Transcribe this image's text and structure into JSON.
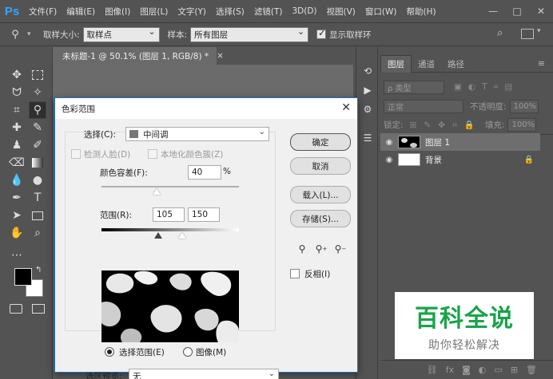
{
  "app": {
    "logo": "Ps",
    "menu": [
      "文件(F)",
      "编辑(E)",
      "图像(I)",
      "图层(L)",
      "文字(Y)",
      "选择(S)",
      "滤镜(T)",
      "3D(D)",
      "视图(V)",
      "窗口(W)",
      "帮助(H)"
    ],
    "window_controls": [
      "—",
      "□",
      "✕"
    ]
  },
  "options_bar": {
    "sample_size_label": "取样大小:",
    "sample_size_value": "取样点",
    "sample_label": "样本:",
    "sample_value": "所有图层",
    "show_ring_label": "显示取样环",
    "show_ring_checked": true
  },
  "document": {
    "tab_title": "未标题-1 @ 50.1% (图层 1, RGB/8) *",
    "tab_close": "×"
  },
  "layers_panel": {
    "tabs": [
      "图层",
      "通道",
      "路径"
    ],
    "active_tab": "图层",
    "filter_label": "ρ 类型",
    "blend_mode": "正常",
    "opacity_label": "不透明度:",
    "opacity_value": "100%",
    "lock_label": "锁定:",
    "fill_label": "填充:",
    "fill_value": "100%",
    "layers": [
      {
        "name": "图层 1",
        "selected": true
      },
      {
        "name": "背景",
        "selected": false
      }
    ],
    "bottom_icons": [
      "link-icon",
      "fx-icon",
      "mask-icon",
      "adjustment-icon",
      "folder-icon",
      "new-layer-icon",
      "trash-icon"
    ]
  },
  "dialog": {
    "title": "色彩范围",
    "close": "✕",
    "select_label": "选择(C):",
    "select_value": "中间调",
    "detect_faces_label": "检测人脸(D)",
    "localized_clusters_label": "本地化颜色簇(Z)",
    "fuzziness_label": "颜色容差(F):",
    "fuzziness_value": "40",
    "fuzziness_unit": "%",
    "range_label": "范围(R):",
    "range_low": "105",
    "range_high": "150",
    "radio_selection": "选择范围(E)",
    "radio_image": "图像(M)",
    "selected_radio": "selection",
    "preview_label": "选区预览:",
    "preview_value": "无",
    "invert_label": "反相(I)",
    "buttons": {
      "ok": "确定",
      "cancel": "取消",
      "load": "载入(L)...",
      "save": "存储(S)..."
    },
    "fuzziness_fraction": 0.4,
    "range_fraction_low": 0.41,
    "range_fraction_high": 0.59
  },
  "watermark": {
    "title": "百科全说",
    "subtitle": "助你轻松解决"
  },
  "colors": {
    "photoshop_blue": "#31a8ff",
    "watermark_green": "#1aa34a"
  }
}
